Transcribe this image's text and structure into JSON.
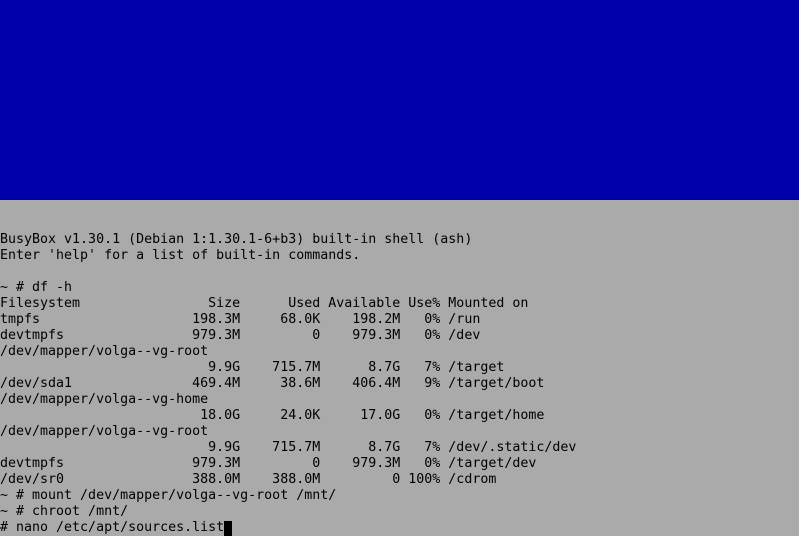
{
  "colors": {
    "top_band": "#0000aa",
    "terminal_background": "#aaaaaa",
    "text": "#000000"
  },
  "terminal": {
    "lines": [
      "BusyBox v1.30.1 (Debian 1:1.30.1-6+b3) built-in shell (ash)",
      "Enter 'help' for a list of built-in commands.",
      "",
      "~ # df -h",
      "Filesystem                Size      Used Available Use% Mounted on",
      "tmpfs                   198.3M     68.0K    198.2M   0% /run",
      "devtmpfs                979.3M         0    979.3M   0% /dev",
      "/dev/mapper/volga--vg-root",
      "                          9.9G    715.7M      8.7G   7% /target",
      "/dev/sda1               469.4M     38.6M    406.4M   9% /target/boot",
      "/dev/mapper/volga--vg-home",
      "                         18.0G     24.0K     17.0G   0% /target/home",
      "/dev/mapper/volga--vg-root",
      "                          9.9G    715.7M      8.7G   7% /dev/.static/dev",
      "devtmpfs                979.3M         0    979.3M   0% /target/dev",
      "/dev/sr0                388.0M    388.0M         0 100% /cdrom",
      "~ # mount /dev/mapper/volga--vg-root /mnt/",
      "~ # chroot /mnt/"
    ],
    "current_command": "# nano /etc/apt/sources.list"
  }
}
